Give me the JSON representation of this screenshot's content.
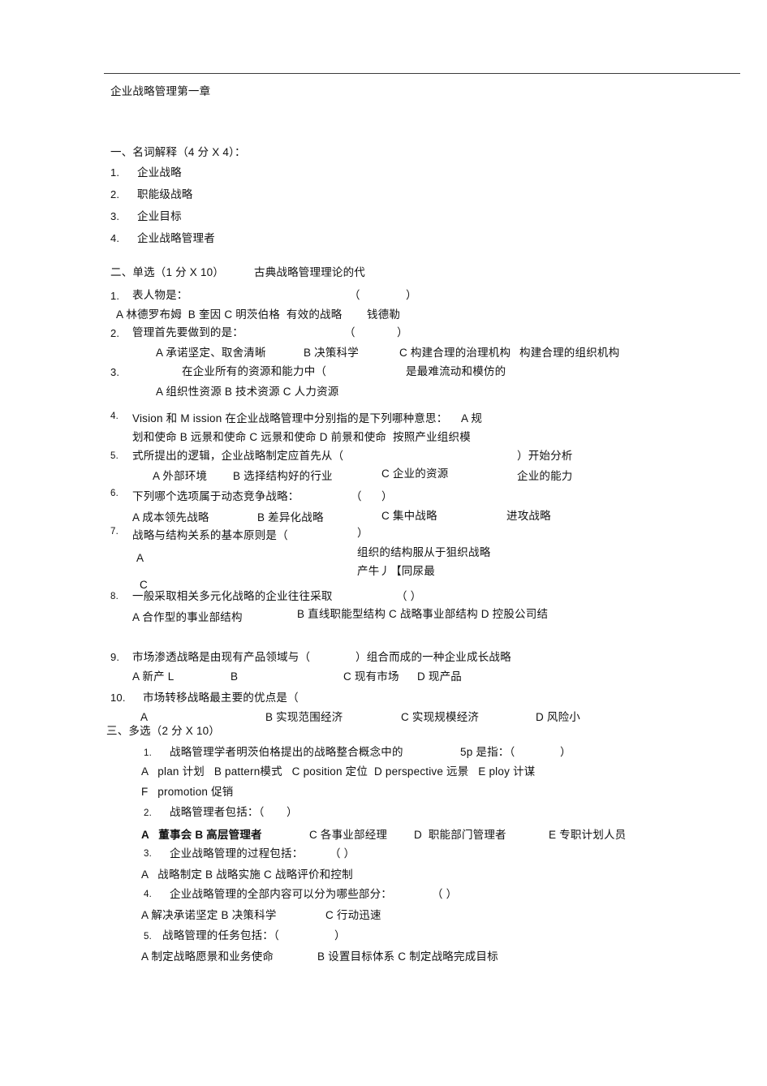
{
  "document": {
    "title": "企业战略管理第一章",
    "has_top_rule": true,
    "text_color": "#111111",
    "rule_color": "#3a3a3a",
    "background": "#ffffff"
  },
  "section1": {
    "heading": "一、名词解释（4 分 X 4）：",
    "items": [
      {
        "num": "1.",
        "text": "企业战略"
      },
      {
        "num": "2.",
        "text": "职能级战略"
      },
      {
        "num": "3.",
        "text": "企业目标"
      },
      {
        "num": "4.",
        "text": "企业战略管理者"
      }
    ]
  },
  "section2": {
    "heading": "二、单选（1 分 X 10）",
    "heading_tail": "古典战略管理理论的代",
    "q1": {
      "num": "1.",
      "stem": "表人物是：",
      "paren_open": "（",
      "paren_close": "）",
      "options": "A 林德罗布姆  B 奎因 C 明茨伯格  有效的战略",
      "option_tail": "钱德勒"
    },
    "q2": {
      "num": "2.",
      "stem": "管理首先要做到的是：",
      "paren_open": "（",
      "paren_close": "）",
      "opt_a": "A 承诺坚定、取舍清晰",
      "opt_b": "B 决策科学",
      "opt_c": "C 构建合理的治理机构",
      "opt_d": "构建合理的组织机构"
    },
    "q3": {
      "num": "3.",
      "stem": "在企业所有的资源和能力中（",
      "stem_tail": "是最难流动和模仿的",
      "options": "A 组织性资源 B 技术资源 C 人力资源"
    },
    "q4": {
      "num": "4.",
      "line1": "Vision 和 M ission 在企业战略管理中分别指的是下列哪种意思：",
      "line1_tail": "A 规",
      "line2": "划和使命 B 远景和使命 C 远景和使命 D 前景和使命  按照产业组织模"
    },
    "q5": {
      "num": "5.",
      "stem": "式所提出的逻辑，企业战略制定应首先从（",
      "stem_tail": "）开始分析",
      "opt_a": "A 外部环境",
      "opt_b": "B 选择结构好的行业",
      "opt_c": "C 企业的资源",
      "opt_d": "企业的能力"
    },
    "q6": {
      "num": "6.",
      "stem": "下列哪个选项属于动态竞争战略：",
      "paren_open": "（",
      "paren_close": "）",
      "opt_a": "A 成本领先战略",
      "opt_b": "B 差异化战略",
      "opt_c": "C 集中战略",
      "opt_d": "进攻战略"
    },
    "q7": {
      "num": "7.",
      "stem": "战略与结构关系的基本原则是（",
      "paren_close": "）",
      "opt_a_label": "A",
      "opt_a_text": "组织的结构服从于狙织战略",
      "opt_garbled": "产牛丿【同尿最",
      "opt_c_label": "C"
    },
    "q8": {
      "num": "8.",
      "stem": "一般采取相关多元化战略的企业往往采取",
      "paren": "（ ）",
      "opt_a": "A 合作型的事业部结构",
      "opt_rest": "B 直线职能型结构 C 战略事业部结构 D 控股公司结"
    },
    "q9": {
      "num": "9.",
      "stem": "市场渗透战略是由现有产品领域与（",
      "stem_tail": "）组合而成的一种企业成长战略",
      "opt_a": "A 新产 L",
      "opt_b": "B",
      "opt_c": "C 现有市场",
      "opt_d": "D 现产品"
    },
    "q10": {
      "num": "10.",
      "stem": "市场转移战略最主要的优点是（",
      "opt_a": "A",
      "opt_b": "B 实现范围经济",
      "opt_c": "C 实现规模经济",
      "opt_d": "D 风险小"
    }
  },
  "section3": {
    "heading": "三、多选（2 分 X 10）",
    "q1": {
      "num": "1.",
      "stem": "战略管理学者明茨伯格提出的战略整合概念中的",
      "stem_tail": "5p 是指：（",
      "paren_close": "）",
      "opt_line": "A   plan 计划   B pattern模式   C position 定位  D perspective 远景   E ploy 计谋",
      "opt_line2": "F   promotion 促销"
    },
    "q2": {
      "num": "2.",
      "stem": "战略管理者包括：（",
      "paren_close": "）",
      "opt_a": "A   董事会 B 高层管理者",
      "opt_c": "C 各事业部经理",
      "opt_d": "D  职能部门管理者",
      "opt_e": "E 专职计划人员"
    },
    "q3": {
      "num": "3.",
      "stem": "企业战略管理的过程包括：",
      "paren": "（ ）",
      "opt_line": "A   战略制定 B 战略实施 C 战略评价和控制"
    },
    "q4": {
      "num": "4.",
      "stem": "企业战略管理的全部内容可以分为哪些部分：",
      "paren": "（ ）",
      "opt_line": "A 解决承诺坚定 B 决策科学",
      "opt_c": "C 行动迅速"
    },
    "q5": {
      "num": "5.",
      "stem": "战略管理的任务包括：（",
      "paren_close": "）",
      "opt_a": "A 制定战略愿景和业务使命",
      "opt_rest": "B 设置目标体系 C 制定战略完成目标"
    }
  }
}
